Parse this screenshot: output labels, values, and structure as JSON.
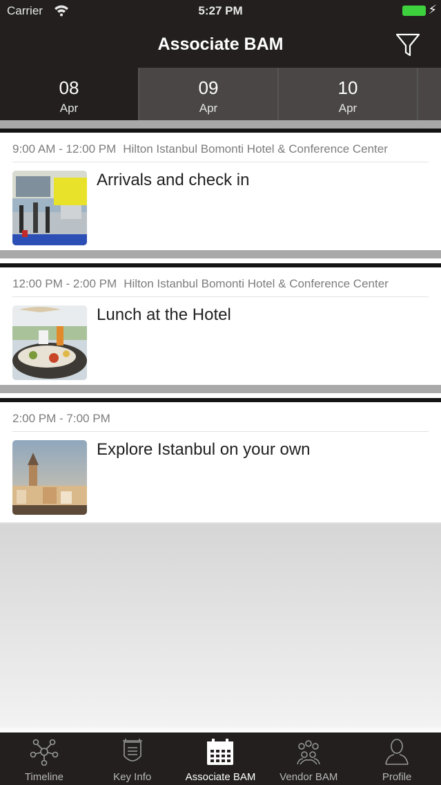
{
  "status_bar": {
    "carrier": "Carrier",
    "time": "5:27 PM"
  },
  "nav": {
    "title": "Associate BAM"
  },
  "dates": [
    {
      "day": "08",
      "month": "Apr"
    },
    {
      "day": "09",
      "month": "Apr"
    },
    {
      "day": "10",
      "month": "Apr"
    }
  ],
  "sessions": [
    {
      "time": "9:00 AM - 12:00 PM",
      "location": "Hilton Istanbul Bomonti Hotel & Conference Center",
      "title": "Arrivals and check in"
    },
    {
      "time": "12:00 PM - 2:00 PM",
      "location": "Hilton Istanbul Bomonti Hotel & Conference Center",
      "title": "Lunch at the Hotel"
    },
    {
      "time": "2:00 PM - 7:00 PM",
      "location": "",
      "title": "Explore Istanbul on your own"
    }
  ],
  "tabs": [
    {
      "label": "Timeline",
      "icon": "timeline-icon"
    },
    {
      "label": "Key Info",
      "icon": "key-info-icon"
    },
    {
      "label": "Associate BAM",
      "icon": "calendar-icon"
    },
    {
      "label": "Vendor BAM",
      "icon": "group-icon"
    },
    {
      "label": "Profile",
      "icon": "profile-icon"
    }
  ],
  "colors": {
    "bar_background": "#231f1f",
    "battery": "#3ed13e",
    "active_tab_text": "#ffffff"
  }
}
